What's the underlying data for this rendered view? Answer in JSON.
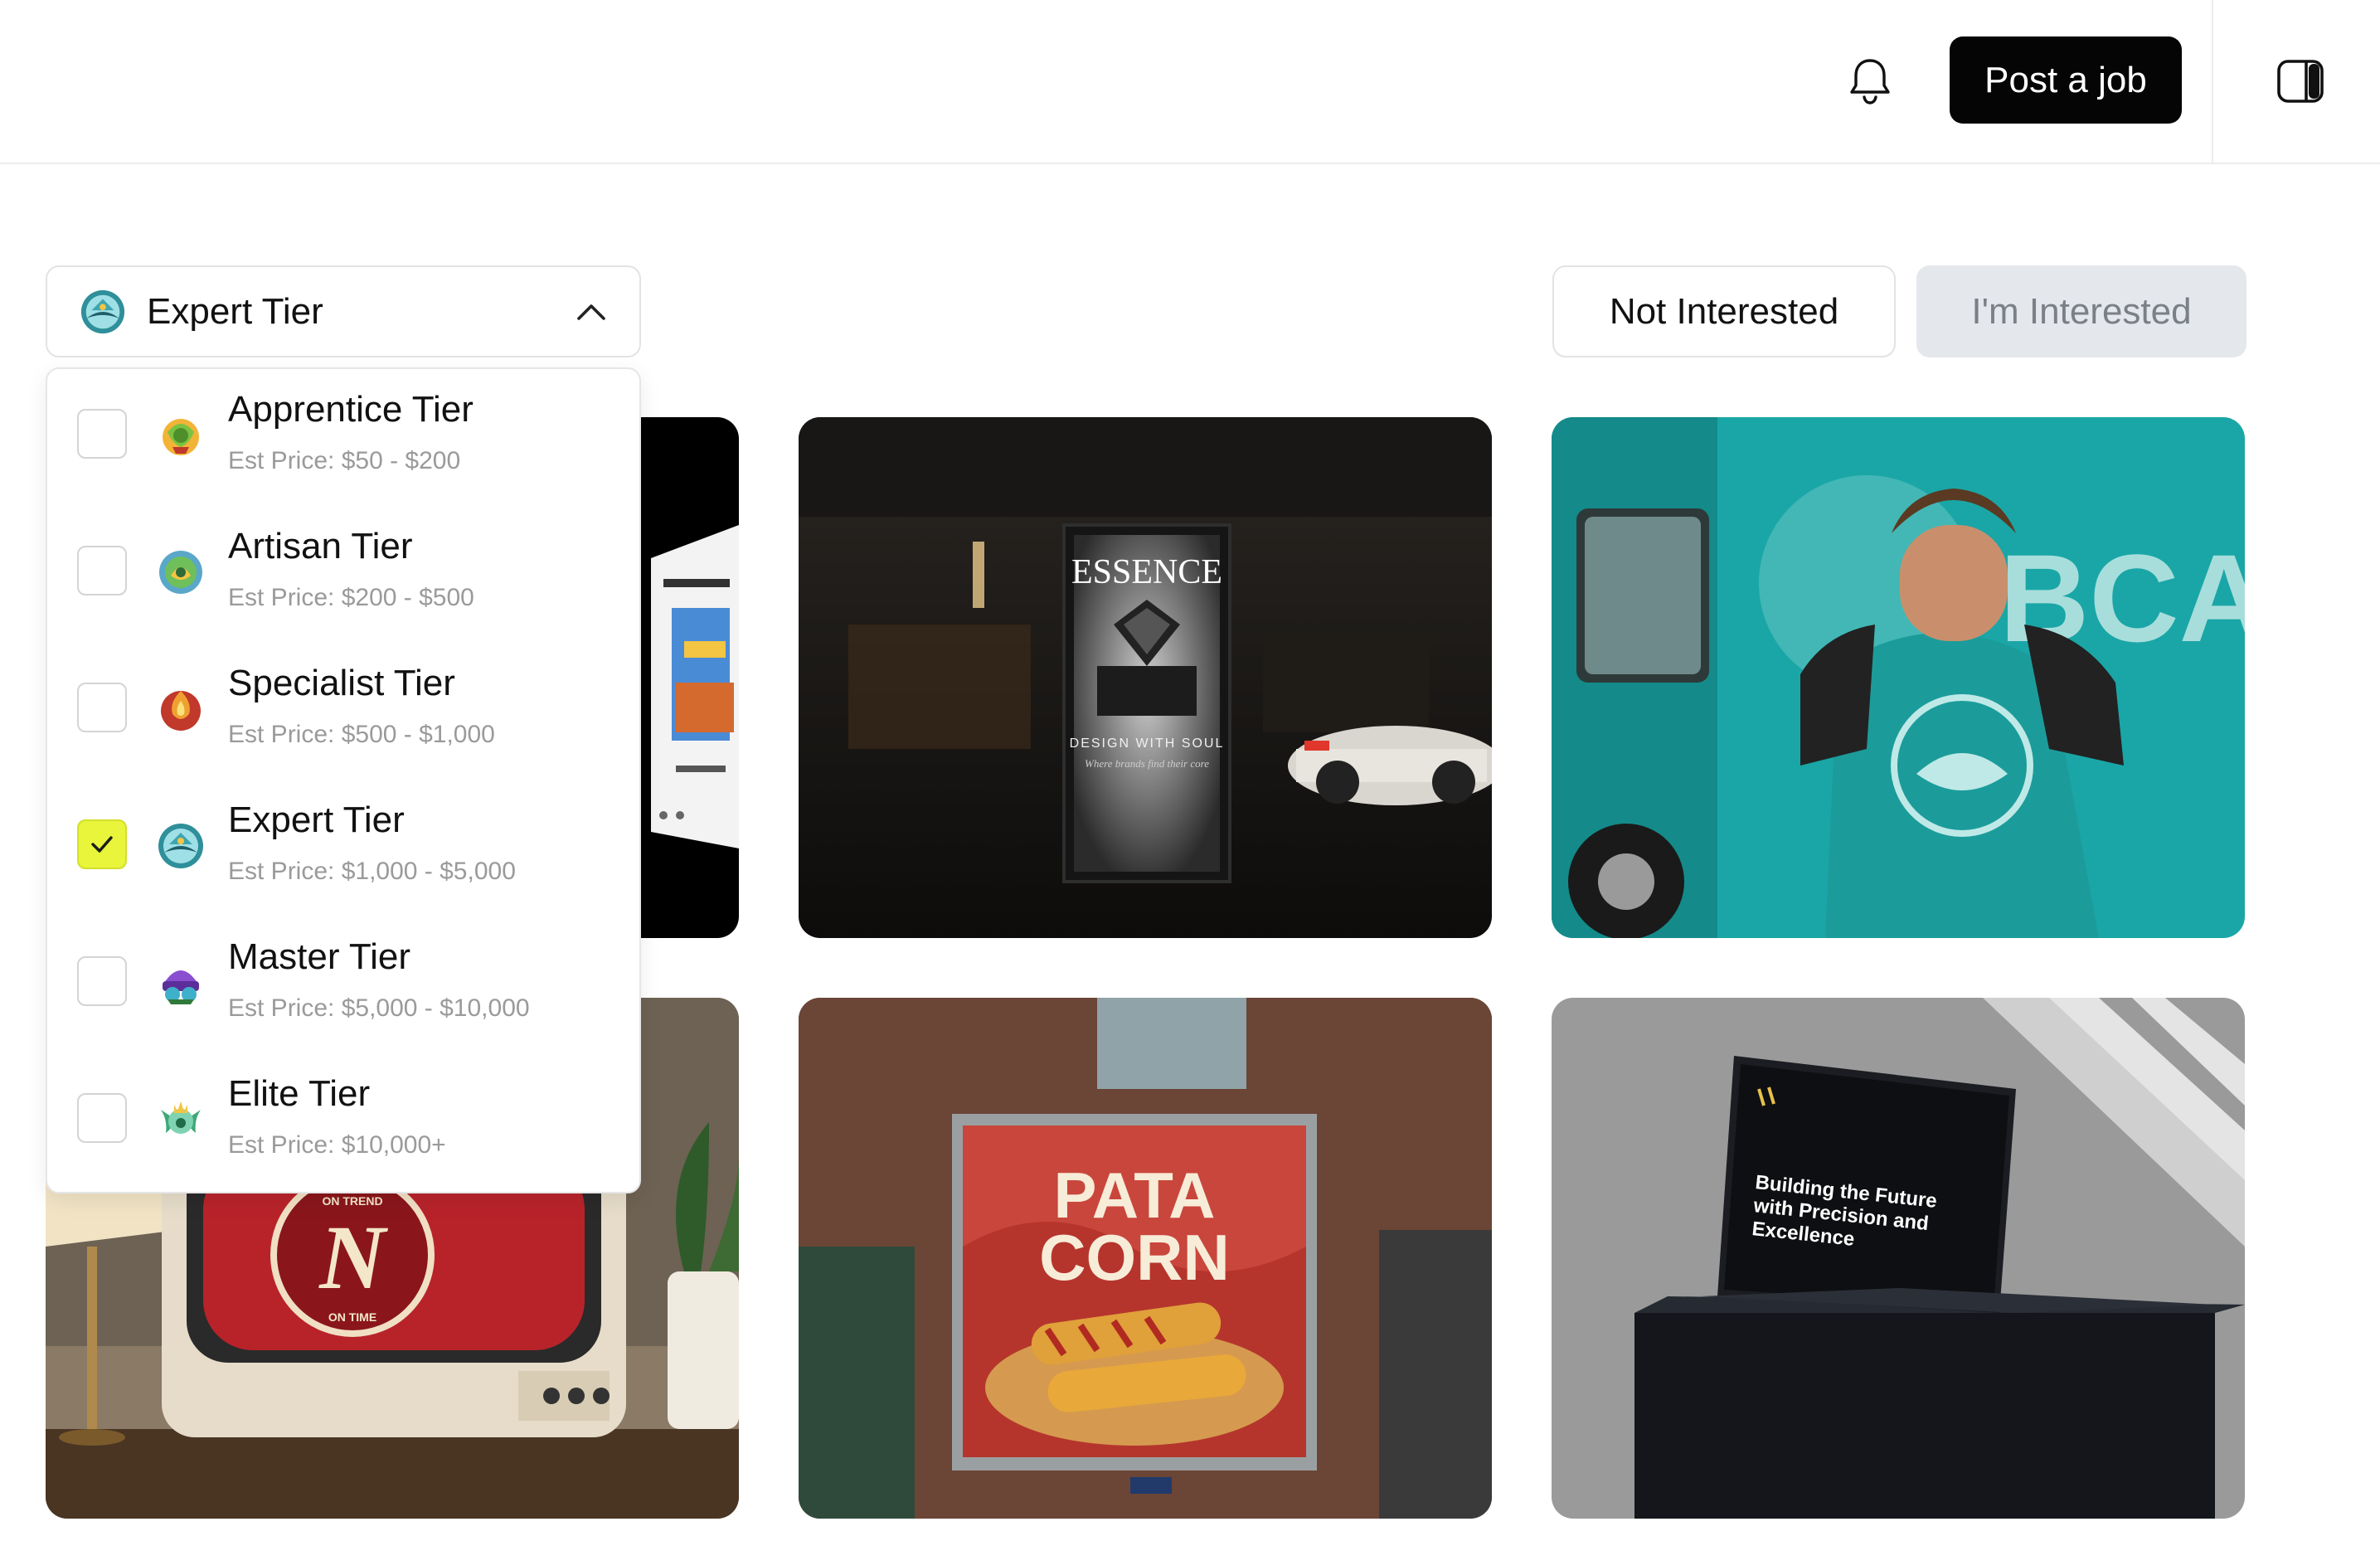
{
  "header": {
    "notifications_icon": "bell-icon",
    "post_job_label": "Post a job",
    "panel_toggle_icon": "sidebar-panel-icon"
  },
  "tier_filter": {
    "selected_label": "Expert Tier",
    "expanded": true,
    "options": [
      {
        "name": "Apprentice Tier",
        "price": "Est Price: $50 - $200",
        "checked": false,
        "badge_color": "#7cc242"
      },
      {
        "name": "Artisan Tier",
        "price": "Est Price: $200 - $500",
        "checked": false,
        "badge_color": "#6fbf5a"
      },
      {
        "name": "Specialist Tier",
        "price": "Est Price: $500 - $1,000",
        "checked": false,
        "badge_color": "#f0a030"
      },
      {
        "name": "Expert Tier",
        "price": "Est Price: $1,000 - $5,000",
        "checked": true,
        "badge_color": "#2f8f9a"
      },
      {
        "name": "Master Tier",
        "price": "Est Price: $5,000 - $10,000",
        "checked": false,
        "badge_color": "#8a4fd0"
      },
      {
        "name": "Elite Tier",
        "price": "Est Price: $10,000+",
        "checked": false,
        "badge_color": "#3fa87a"
      }
    ]
  },
  "actions": {
    "not_interested": "Not Interested",
    "interested": "I'm Interested"
  },
  "gallery": {
    "essence_title": "ESSENCE",
    "essence_tagline": "DESIGN WITH SOUL",
    "essence_sub": "Where brands find their core",
    "truck_brand": "BCA",
    "tv_badge_top": "ON TREND",
    "tv_badge_bottom": "ON TIME",
    "billboard_line1": "PATA",
    "billboard_line2": "CORN",
    "laptop_headline_1": "Building the Future",
    "laptop_headline_2": "with Precision and",
    "laptop_headline_3": "Excellence"
  },
  "colors": {
    "accent_check": "#e8f53a",
    "primary_button": "#050505",
    "secondary_button_bg": "#e4e7eb"
  }
}
